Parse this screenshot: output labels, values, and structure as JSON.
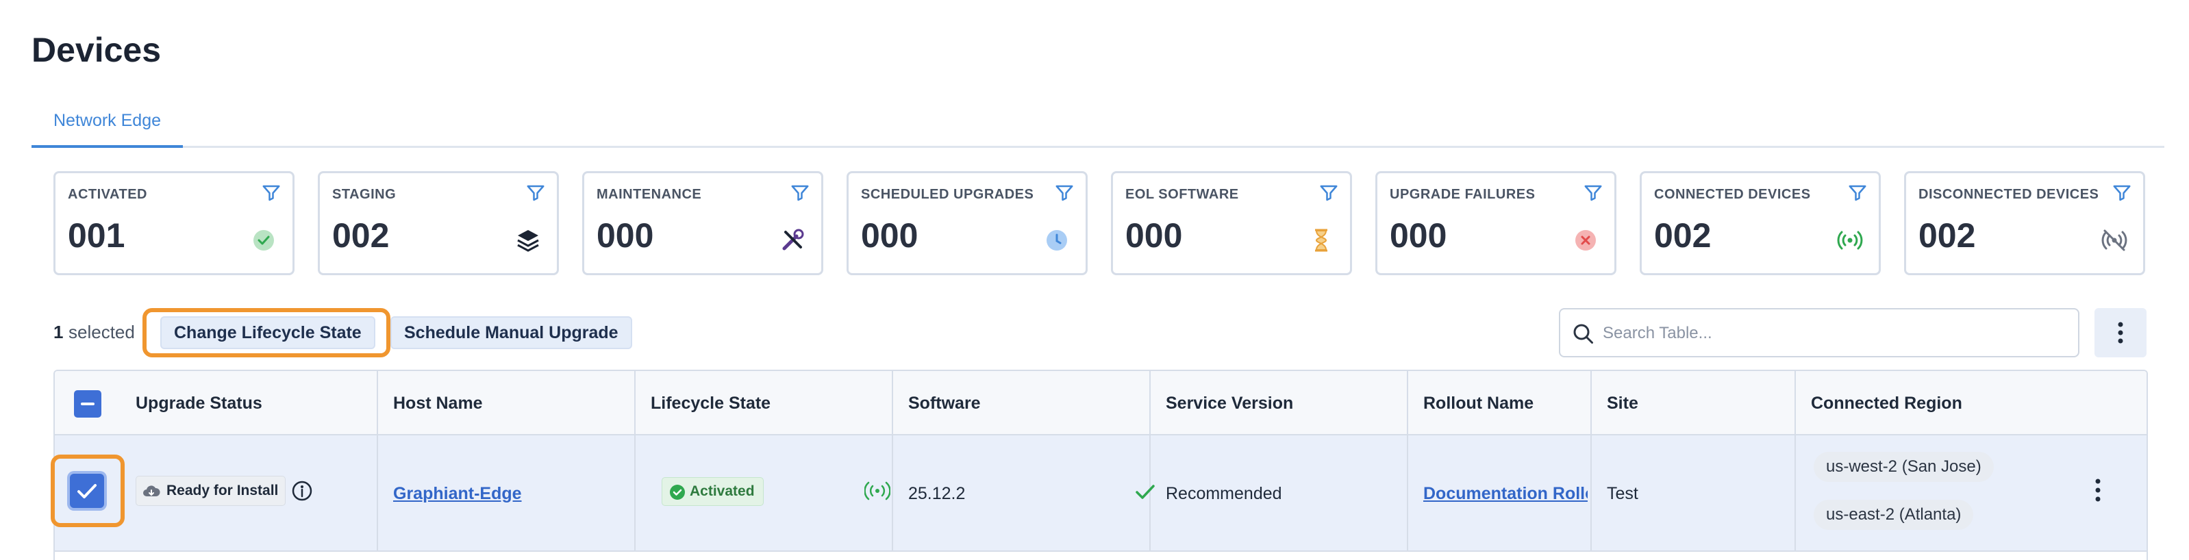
{
  "page": {
    "title": "Devices"
  },
  "tabs": [
    {
      "label": "Network Edge",
      "active": true
    }
  ],
  "cards": [
    {
      "label": "ACTIVATED",
      "value": "001",
      "icon": "check-circle-icon",
      "color": "#2fa84f"
    },
    {
      "label": "STAGING",
      "value": "002",
      "icon": "layers-icon",
      "color": "#1c2433"
    },
    {
      "label": "MAINTENANCE",
      "value": "000",
      "icon": "tools-icon",
      "color": "#5b3a8f"
    },
    {
      "label": "SCHEDULED UPGRADES",
      "value": "000",
      "icon": "clock-icon",
      "color": "#5a9be8"
    },
    {
      "label": "EOL SOFTWARE",
      "value": "000",
      "icon": "hourglass-icon",
      "color": "#e8a23a"
    },
    {
      "label": "UPGRADE FAILURES",
      "value": "000",
      "icon": "error-circle-icon",
      "color": "#e24b4b"
    },
    {
      "label": "CONNECTED DEVICES",
      "value": "002",
      "icon": "signal-icon",
      "color": "#2fa84f"
    },
    {
      "label": "DISCONNECTED DEVICES",
      "value": "002",
      "icon": "signal-off-icon",
      "color": "#6b7280"
    }
  ],
  "toolbar": {
    "selected_count": "1",
    "selected_label": "selected",
    "change_lifecycle_label": "Change Lifecycle State",
    "schedule_upgrade_label": "Schedule Manual Upgrade",
    "search_placeholder": "Search Table..."
  },
  "table": {
    "columns": [
      "Upgrade Status",
      "Host Name",
      "Lifecycle State",
      "Software",
      "Service Version",
      "Rollout Name",
      "Site",
      "Connected Region"
    ],
    "rows": [
      {
        "selected": true,
        "upgrade_status": "Ready for Install",
        "host_name": "Graphiant-Edge",
        "lifecycle_state": "Activated",
        "software": "25.12.2",
        "service_version": "Recommended",
        "rollout_name": "Documentation Rollout",
        "site": "Test",
        "regions": [
          "us-west-2 (San Jose)",
          "us-east-2 (Atlanta)"
        ]
      }
    ]
  },
  "colors": {
    "accent": "#3f86d8",
    "highlight": "#f0962f",
    "link": "#3266c8",
    "selected_row": "#e9effa"
  }
}
